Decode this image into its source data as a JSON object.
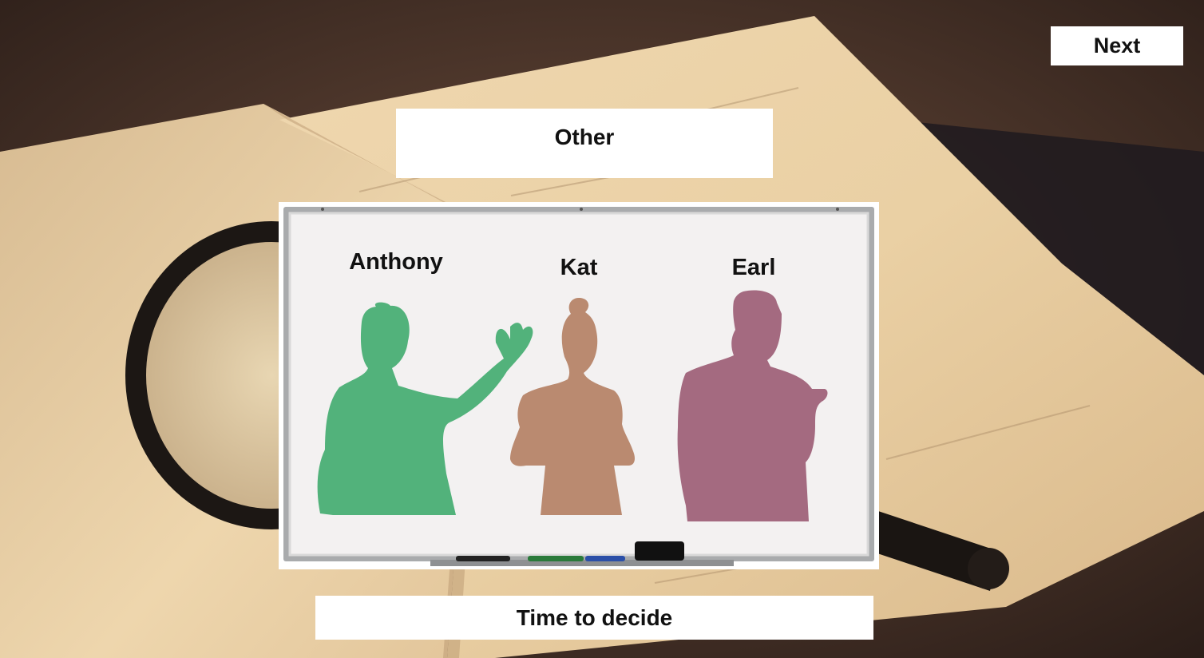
{
  "navigation": {
    "next_label": "Next"
  },
  "scene": {
    "category_label": "Other",
    "prompt_label": "Time to decide"
  },
  "characters": [
    {
      "name": "Anthony",
      "color": "#52b27b"
    },
    {
      "name": "Kat",
      "color": "#ba8a70"
    },
    {
      "name": "Earl",
      "color": "#a46a80"
    }
  ],
  "background": {
    "page_color": "#e8cfa4",
    "shadow_color": "#2e211c"
  }
}
